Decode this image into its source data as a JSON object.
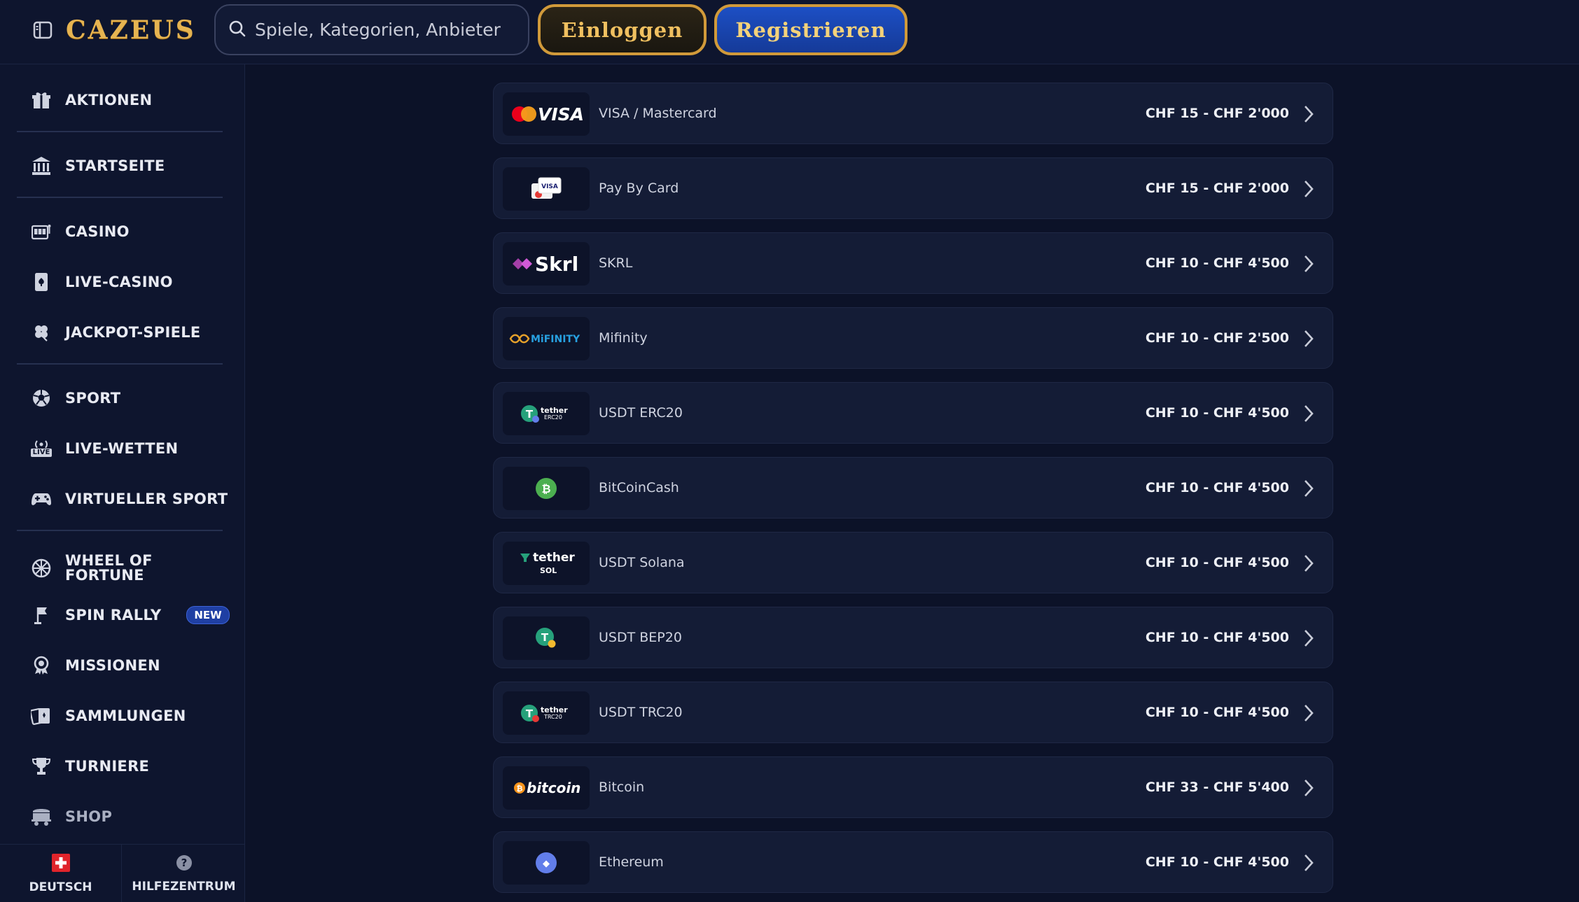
{
  "header": {
    "logo": "CAZEUS",
    "search_placeholder": "Spiele, Kategorien, Anbieter",
    "login_label": "Einloggen",
    "register_label": "Registrieren"
  },
  "sidebar": {
    "items": [
      {
        "label": "AKTIONEN",
        "icon": "gift-icon"
      },
      {
        "label": "STARTSEITE",
        "icon": "bank-icon"
      },
      {
        "label": "CASINO",
        "icon": "slot-machine-icon"
      },
      {
        "label": "LIVE-CASINO",
        "icon": "playing-card-icon"
      },
      {
        "label": "JACKPOT-SPIELE",
        "icon": "clover-icon"
      },
      {
        "label": "SPORT",
        "icon": "soccer-ball-icon"
      },
      {
        "label": "LIVE-WETTEN",
        "icon": "live-broadcast-icon"
      },
      {
        "label": "VIRTUELLER SPORT",
        "icon": "gamepad-icon"
      },
      {
        "label": "WHEEL OF FORTUNE",
        "icon": "wheel-icon"
      },
      {
        "label": "SPIN RALLY",
        "icon": "flag-icon",
        "badge": "NEW"
      },
      {
        "label": "MISSIONEN",
        "icon": "medal-icon"
      },
      {
        "label": "SAMMLUNGEN",
        "icon": "cards-collection-icon"
      },
      {
        "label": "TURNIERE",
        "icon": "trophy-icon"
      },
      {
        "label": "SHOP",
        "icon": "cart-icon"
      }
    ],
    "language": "DEUTSCH",
    "help": "HILFEZENTRUM",
    "live_icon_text": "LIVE"
  },
  "payments": [
    {
      "name": "VISA / Mastercard",
      "range": "CHF 15 - CHF 2'000",
      "logo": "visa-mastercard",
      "logo_text": "VISA"
    },
    {
      "name": "Pay By Card",
      "range": "CHF 15 - CHF 2'000",
      "logo": "pay-by-card",
      "logo_text": "VISA"
    },
    {
      "name": "SKRL",
      "range": "CHF 10 - CHF 4'500",
      "logo": "skrill",
      "logo_text": "Skrl"
    },
    {
      "name": "Mifinity",
      "range": "CHF 10 - CHF 2'500",
      "logo": "mifinity",
      "logo_text": "MiFINITY"
    },
    {
      "name": "USDT ERC20",
      "range": "CHF 10 - CHF 4'500",
      "logo": "tether-erc20",
      "logo_text": "tether",
      "logo_sub": "ERC20"
    },
    {
      "name": "BitCoinCash",
      "range": "CHF 10 - CHF 4'500",
      "logo": "bitcoin-cash",
      "logo_text": "₿"
    },
    {
      "name": "USDT Solana",
      "range": "CHF 10 - CHF 4'500",
      "logo": "tether-sol",
      "logo_text": "tether",
      "logo_sub": "SOL"
    },
    {
      "name": "USDT BEP20",
      "range": "CHF 10 - CHF 4'500",
      "logo": "tether-bep20",
      "logo_text": "T"
    },
    {
      "name": "USDT TRC20",
      "range": "CHF 10 - CHF 4'500",
      "logo": "tether-trc20",
      "logo_text": "tether",
      "logo_sub": "TRC20"
    },
    {
      "name": "Bitcoin",
      "range": "CHF 33 - CHF 5'400",
      "logo": "bitcoin",
      "logo_text": "bitcoin"
    },
    {
      "name": "Ethereum",
      "range": "CHF 10 - CHF 4'500",
      "logo": "ethereum",
      "logo_text": "◆"
    }
  ]
}
